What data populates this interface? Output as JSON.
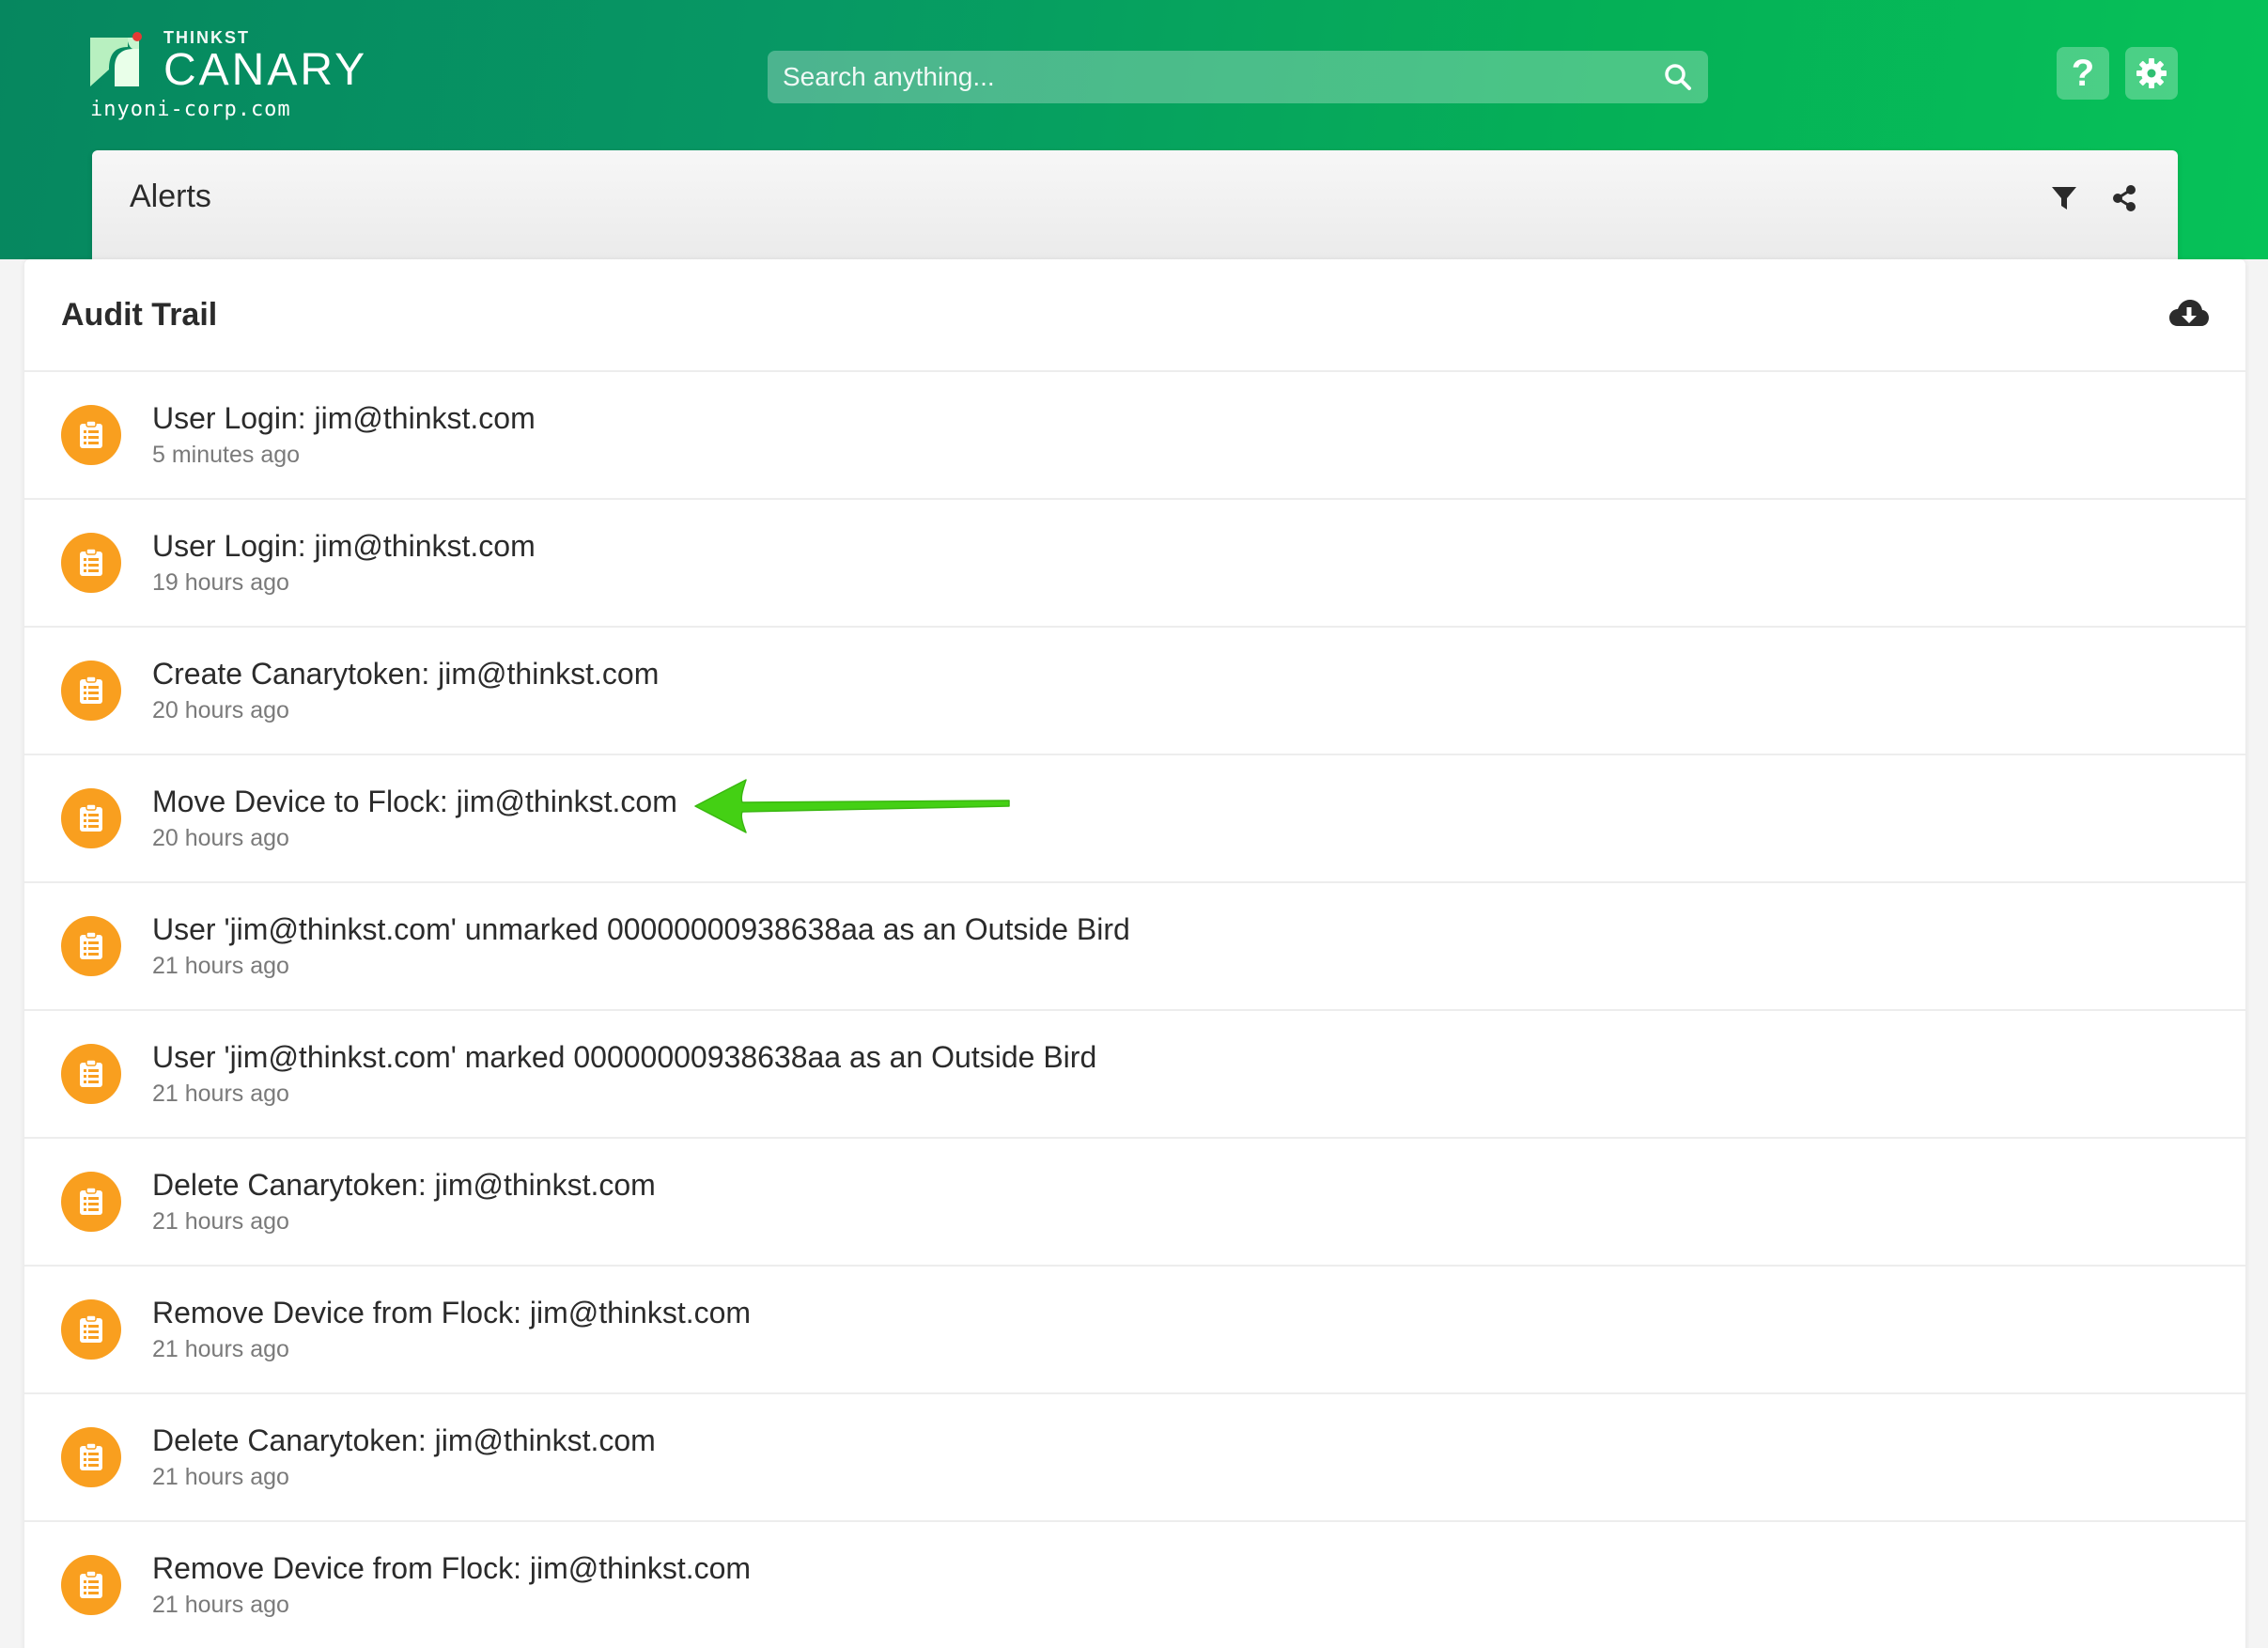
{
  "brand": {
    "small": "THINKST",
    "name": "CANARY",
    "domain": "inyoni-corp.com"
  },
  "search": {
    "placeholder": "Search anything..."
  },
  "header_buttons": {
    "help": "?"
  },
  "alerts": {
    "title": "Alerts"
  },
  "audit": {
    "title": "Audit Trail",
    "events": [
      {
        "title": "User Login: jim@thinkst.com",
        "time": "5 minutes ago"
      },
      {
        "title": "User Login: jim@thinkst.com",
        "time": "19 hours ago"
      },
      {
        "title": "Create Canarytoken: jim@thinkst.com",
        "time": "20 hours ago"
      },
      {
        "title": "Move Device to Flock: jim@thinkst.com",
        "time": "20 hours ago"
      },
      {
        "title": "User 'jim@thinkst.com' unmarked 00000000938638aa as an Outside Bird",
        "time": "21 hours ago"
      },
      {
        "title": "User 'jim@thinkst.com' marked 00000000938638aa as an Outside Bird",
        "time": "21 hours ago"
      },
      {
        "title": "Delete Canarytoken: jim@thinkst.com",
        "time": "21 hours ago"
      },
      {
        "title": "Remove Device from Flock: jim@thinkst.com",
        "time": "21 hours ago"
      },
      {
        "title": "Delete Canarytoken: jim@thinkst.com",
        "time": "21 hours ago"
      },
      {
        "title": "Remove Device from Flock: jim@thinkst.com",
        "time": "21 hours ago"
      }
    ]
  },
  "icons": {
    "logo": "canary-logo-icon",
    "search": "search-icon",
    "help": "question-icon",
    "settings": "gear-icon",
    "filter": "filter-icon",
    "share": "share-icon",
    "download": "cloud-download-icon",
    "event": "clipboard-icon",
    "annotation": "arrow-annotation-icon"
  },
  "colors": {
    "header_start": "#06875f",
    "header_end": "#06c258",
    "badge": "#f99f1f",
    "annotation_arrow": "#44d014"
  }
}
